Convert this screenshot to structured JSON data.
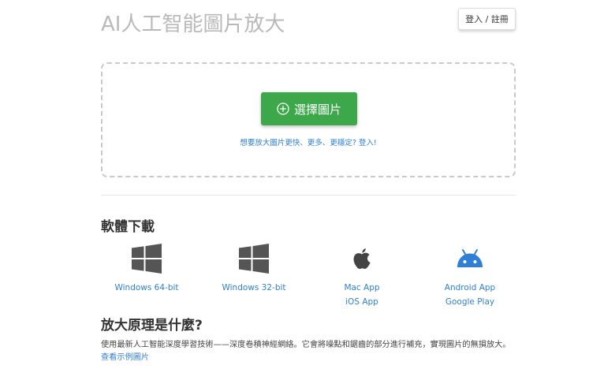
{
  "header": {
    "title": "AI人工智能圖片放大",
    "login_label": "登入 / 註冊"
  },
  "upload": {
    "button_label": "選擇圖片",
    "button_icon": "plus-circle-icon",
    "hint": "想要放大圖片更快、更多、更穩定? 登入!"
  },
  "downloads": {
    "title": "軟體下載",
    "items": [
      {
        "icon": "windows-icon",
        "links": [
          "Windows 64-bit"
        ]
      },
      {
        "icon": "windows-icon",
        "links": [
          "Windows 32-bit"
        ]
      },
      {
        "icon": "apple-icon",
        "links": [
          "Mac App",
          "iOS App"
        ]
      },
      {
        "icon": "android-icon",
        "links": [
          "Android App",
          "Google Play"
        ]
      }
    ]
  },
  "principle": {
    "title": "放大原理是什麼?",
    "text": "使用最新人工智能深度學習技術——深度卷積神經網絡。它會將噪點和鋸齒的部分進行補充，實現圖片的無損放大。",
    "link": "查看示例圖片"
  },
  "colors": {
    "accent_green": "#3ca84a",
    "link_blue": "#2f7fd6",
    "title_gray": "#b9b9b9",
    "android_blue": "#2f7fd6"
  }
}
